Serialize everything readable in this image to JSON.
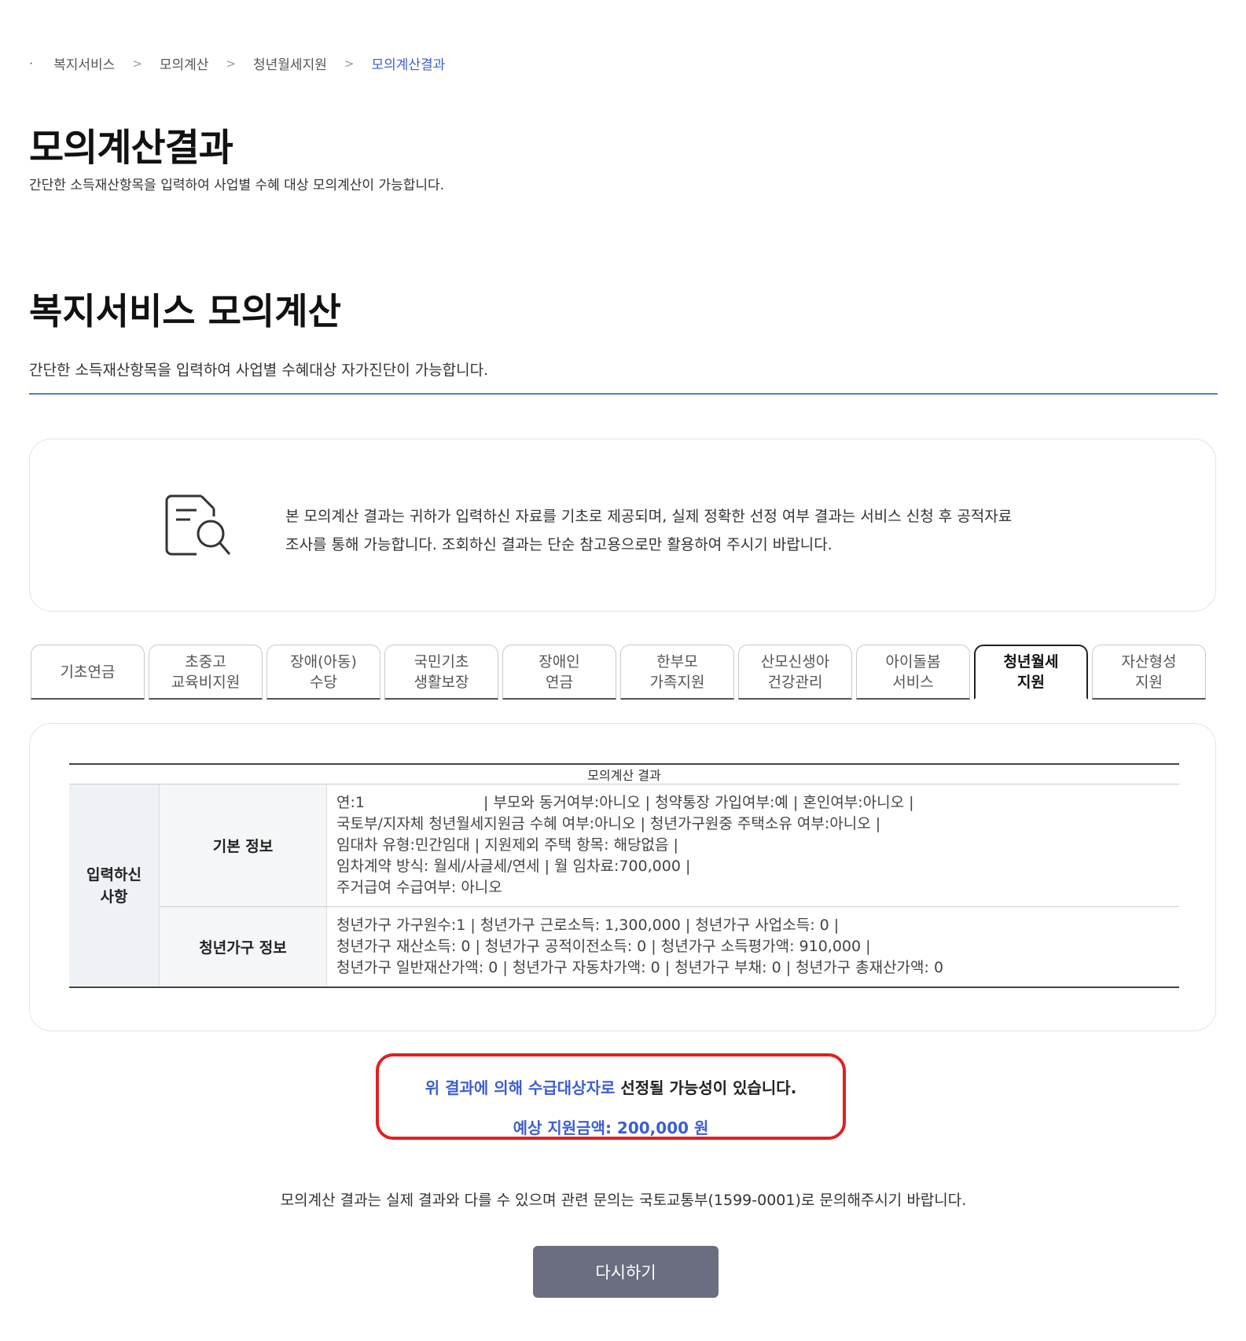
{
  "breadcrumb": {
    "items": [
      "복지서비스",
      "모의계산",
      "청년월세지원"
    ],
    "current": "모의계산결과"
  },
  "page": {
    "title": "모의계산결과",
    "subtitle": "간단한 소득재산항목을 입력하여 사업별 수혜 대상 모의계산이 가능합니다."
  },
  "section": {
    "title": "복지서비스 모의계산",
    "subtitle": "간단한 소득재산항목을 입력하여 사업별 수혜대상 자가진단이 가능합니다."
  },
  "notice": {
    "icon": "document-search-icon",
    "text_line1": "본 모의계산 결과는 귀하가 입력하신 자료를 기초로 제공되며, 실제 정확한 선정 여부 결과는 서비스 신청 후 공적자료",
    "text_line2": "조사를 통해 가능합니다. 조회하신 결과는 단순 참고용으로만 활용하여 주시기 바랍니다."
  },
  "tabs": [
    {
      "label": "기초연금"
    },
    {
      "label": "초중고\n교육비지원"
    },
    {
      "label": "장애(아동)\n수당"
    },
    {
      "label": "국민기초\n생활보장"
    },
    {
      "label": "장애인\n연금"
    },
    {
      "label": "한부모\n가족지원"
    },
    {
      "label": "산모신생아\n건강관리"
    },
    {
      "label": "아이돌봄\n서비스"
    },
    {
      "label": "청년월세\n지원",
      "active": true
    },
    {
      "label": "자산형성\n지원"
    }
  ],
  "result": {
    "caption": "모의계산 결과",
    "category": "입력하신\n사항",
    "rows": [
      {
        "label": "기본 정보",
        "lines": [
          "연:1                         | 부모와 동거여부:아니오 | 청약통장 가입여부:예 | 혼인여부:아니오 |",
          "국토부/지자체 청년월세지원금 수혜 여부:아니오 | 청년가구원중 주택소유 여부:아니오 |",
          "임대차 유형:민간임대 | 지원제외 주택 항목: 해당없음 |",
          "임차계약 방식: 월세/사글세/연세 | 월 임차료:700,000 |",
          "주거급여 수급여부: 아니오"
        ]
      },
      {
        "label": "청년가구 정보",
        "lines": [
          "청년가구 가구원수:1 | 청년가구 근로소득: 1,300,000 | 청년가구 사업소득: 0 |",
          "청년가구 재산소득: 0 | 청년가구 공적이전소득: 0 | 청년가구 소득평가액: 910,000 |",
          "청년가구 일반재산가액: 0 | 청년가구 자동차가액: 0 | 청년가구 부채: 0 | 청년가구 총재산가액: 0"
        ]
      }
    ]
  },
  "outcome": {
    "part1": "위 결과에 의해 수급대상자로",
    "part2": " 선정될 가능성이 있습니다.",
    "amount": "예상 지원금액: 200,000 원"
  },
  "footer_note": "모의계산 결과는 실제 결과와 다를 수 있으며 관련 문의는 국토교통부(1599-0001)로 문의해주시기 바랍니다.",
  "retry_label": "다시하기",
  "colors": {
    "accent_blue": "#3b5fd1",
    "section_line": "#4a7fd9",
    "highlight_border": "#e02020",
    "button_bg": "#6b6e80"
  }
}
